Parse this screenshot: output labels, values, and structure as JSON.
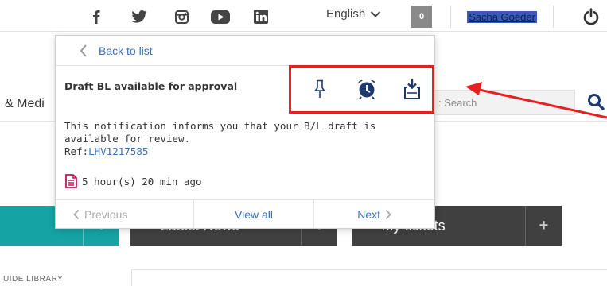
{
  "topbar": {
    "social_icons": [
      "facebook-icon",
      "twitter-icon",
      "instagram-icon",
      "youtube-icon",
      "linkedin-icon"
    ],
    "language": "English",
    "notification_count": "0",
    "user_name": "Sacha Goeder",
    "power_icon": "power-icon"
  },
  "page": {
    "brand_fragment": "& Medi",
    "search_placeholder": ": Search",
    "tiles": {
      "news_label": "Latest News",
      "tickets_label": "My tickets",
      "plus": "+"
    },
    "library_label": "UIDE LIBRARY"
  },
  "popup": {
    "back_label": "Back to list",
    "title": "Draft BL available for approval",
    "message": "This notification informs you that your B/L draft is available for review.",
    "ref_prefix": "Ref:",
    "ref_value": "LHV1217585",
    "time": "5 hour(s) 20 min ago",
    "actions": [
      "pin-icon",
      "alarm-clock-icon",
      "download-tray-icon"
    ],
    "nav": {
      "previous": "Previous",
      "view_all": "View all",
      "next": "Next"
    }
  },
  "colors": {
    "accent_blue": "#3a6fb8",
    "annotation_red": "#e62020",
    "tile_teal": "#16a3a3",
    "tile_dark": "#404040",
    "doc_icon_pink": "#c2185b"
  }
}
